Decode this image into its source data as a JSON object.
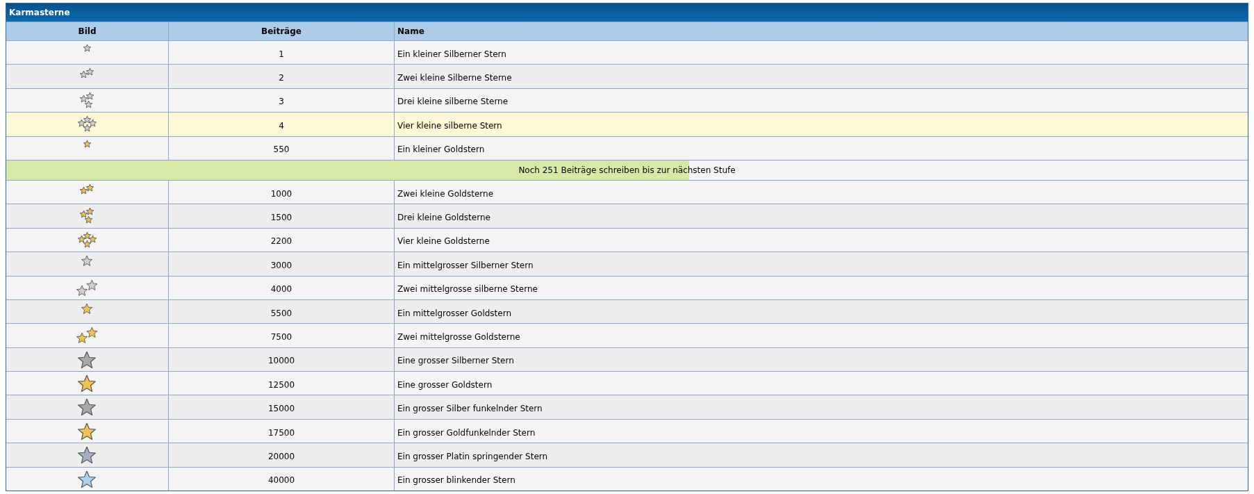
{
  "panel": {
    "title": "Karmasterne"
  },
  "table": {
    "columns": [
      "Bild",
      "Beiträge",
      "Name"
    ],
    "rows": [
      {
        "kind": "rank",
        "image": {
          "kind": "single-small",
          "color": "#d0d0d0"
        },
        "posts": "1",
        "name": "Ein kleiner Silberner Stern",
        "highlighted": false
      },
      {
        "kind": "rank",
        "image": {
          "kind": "pair-small",
          "color": "#d0d0d0"
        },
        "posts": "2",
        "name": "Zwei kleine Silberne Sterne",
        "highlighted": false
      },
      {
        "kind": "rank",
        "image": {
          "kind": "trio-small",
          "color": "#d0d0d0"
        },
        "posts": "3",
        "name": "Drei kleine silberne Sterne",
        "highlighted": false
      },
      {
        "kind": "rank",
        "image": {
          "kind": "quad-small",
          "color": "#d0d0d0"
        },
        "posts": "4",
        "name": "Vier kleine silberne Stern",
        "highlighted": true
      },
      {
        "kind": "rank",
        "image": {
          "kind": "single-small",
          "color": "#f2c14e"
        },
        "posts": "550",
        "name": "Ein kleiner Goldstern",
        "highlighted": false
      },
      {
        "kind": "progress",
        "text": "Noch 251 Beiträge schreiben bis zur nächsten Stufe",
        "level": 0.55
      },
      {
        "kind": "rank",
        "image": {
          "kind": "pair-small",
          "color": "#f2c14e"
        },
        "posts": "1000",
        "name": "Zwei kleine Goldsterne",
        "highlighted": false
      },
      {
        "kind": "rank",
        "image": {
          "kind": "trio-small",
          "color": "#f2c14e"
        },
        "posts": "1500",
        "name": "Drei kleine Goldsterne",
        "highlighted": false
      },
      {
        "kind": "rank",
        "image": {
          "kind": "quad-small",
          "color": "#f2c14e"
        },
        "posts": "2200",
        "name": "Vier kleine Goldsterne",
        "highlighted": false
      },
      {
        "kind": "rank",
        "image": {
          "kind": "single-medium",
          "color": "#d0d0d0"
        },
        "posts": "3000",
        "name": "Ein mittelgrosser Silberner Stern",
        "highlighted": false
      },
      {
        "kind": "rank",
        "image": {
          "kind": "pair-medium",
          "color": "#d0d0d0"
        },
        "posts": "4000",
        "name": "Zwei mittelgrosse silberne Sterne",
        "highlighted": false
      },
      {
        "kind": "rank",
        "image": {
          "kind": "single-medium",
          "color": "#f2c14e"
        },
        "posts": "5500",
        "name": "Ein mittelgrosser Goldstern",
        "highlighted": false
      },
      {
        "kind": "rank",
        "image": {
          "kind": "pair-medium",
          "color": "#f2c14e"
        },
        "posts": "7500",
        "name": "Zwei mittelgrosse Goldsterne",
        "highlighted": false
      },
      {
        "kind": "rank",
        "image": {
          "kind": "single-large",
          "color": "#a8a8a8"
        },
        "posts": "10000",
        "name": "Eine grosser Silberner Stern",
        "highlighted": false
      },
      {
        "kind": "rank",
        "image": {
          "kind": "single-large",
          "color": "#f2c14e"
        },
        "posts": "12500",
        "name": "Eine grosser Goldstern",
        "highlighted": false
      },
      {
        "kind": "rank",
        "image": {
          "kind": "single-large",
          "color": "#a8a8a8"
        },
        "posts": "15000",
        "name": "Ein grosser Silber funkelnder Stern",
        "highlighted": false
      },
      {
        "kind": "rank",
        "image": {
          "kind": "single-large",
          "color": "#f2c14e"
        },
        "posts": "17500",
        "name": "Ein grosser Goldfunkelnder Stern",
        "highlighted": false
      },
      {
        "kind": "rank",
        "image": {
          "kind": "single-large",
          "color": "#a4aec4"
        },
        "posts": "20000",
        "name": "Ein grosser Platin springender Stern",
        "highlighted": false
      },
      {
        "kind": "rank",
        "image": {
          "kind": "single-large",
          "color": "#a8d4f4"
        },
        "posts": "40000",
        "name": "Ein grosser blinkender Stern",
        "highlighted": false
      }
    ]
  }
}
